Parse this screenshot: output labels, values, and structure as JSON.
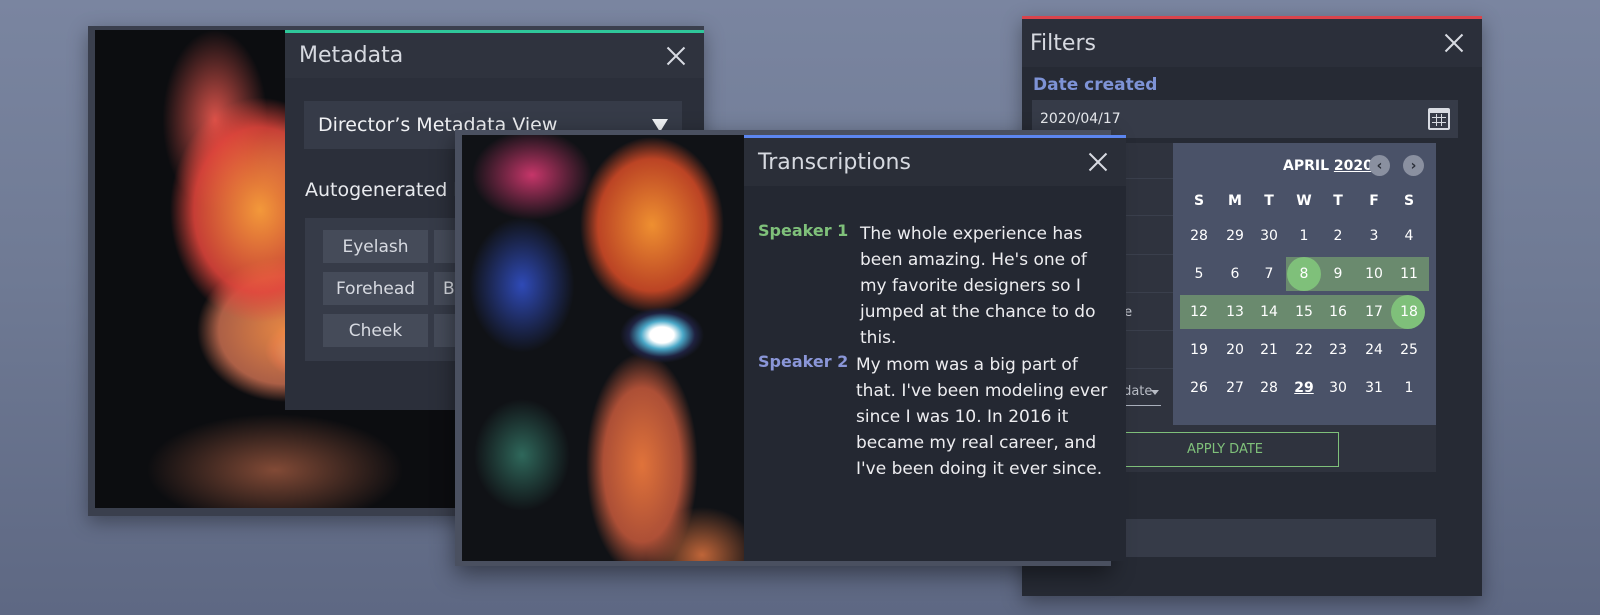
{
  "metadata": {
    "title": "Metadata",
    "view_select": "Director’s Metadata View",
    "autogenerated_label": "Autogenerated keywords",
    "keywords": [
      "Eyelash",
      "Forehead",
      "B",
      "Cheek"
    ]
  },
  "transcriptions": {
    "title": "Transcriptions",
    "entries": [
      {
        "speaker": "Speaker 1",
        "text": "The whole experience has been amazing. He's one of my favorite designers so I jumped at the chance to do this."
      },
      {
        "speaker": "Speaker 2",
        "text": "My mom was a big part of that. I've been modeling ever since I was 10. In 2016 it became my real career, and I've been doing it ever since."
      }
    ],
    "speaker_colors": [
      "#7fc07a",
      "#8a96d8"
    ]
  },
  "filters": {
    "title": "Filters",
    "date_label": "Date created",
    "date_value": "2020/04/17",
    "presets": [
      "e",
      "te",
      "ate"
    ],
    "to_date_label": "o date",
    "calendar": {
      "month": "APRIL",
      "year": "2020",
      "weekdays": [
        "S",
        "M",
        "T",
        "W",
        "T",
        "F",
        "S"
      ],
      "weeks": [
        [
          "28",
          "29",
          "30",
          "1",
          "2",
          "3",
          "4"
        ],
        [
          "5",
          "6",
          "7",
          "8",
          "9",
          "10",
          "11"
        ],
        [
          "12",
          "13",
          "14",
          "15",
          "16",
          "17",
          "18"
        ],
        [
          "19",
          "20",
          "21",
          "22",
          "23",
          "24",
          "25"
        ],
        [
          "26",
          "27",
          "28",
          "29",
          "30",
          "31",
          "1"
        ]
      ],
      "range_start": "8",
      "range_end": "18",
      "today": "29"
    },
    "apply_label": "APPLY DATE"
  },
  "colors": {
    "metadata_accent": "#2fc79a",
    "transcriptions_accent": "#5c86f0",
    "filters_accent": "#d9444c",
    "selection_green": "#7fc07a"
  }
}
